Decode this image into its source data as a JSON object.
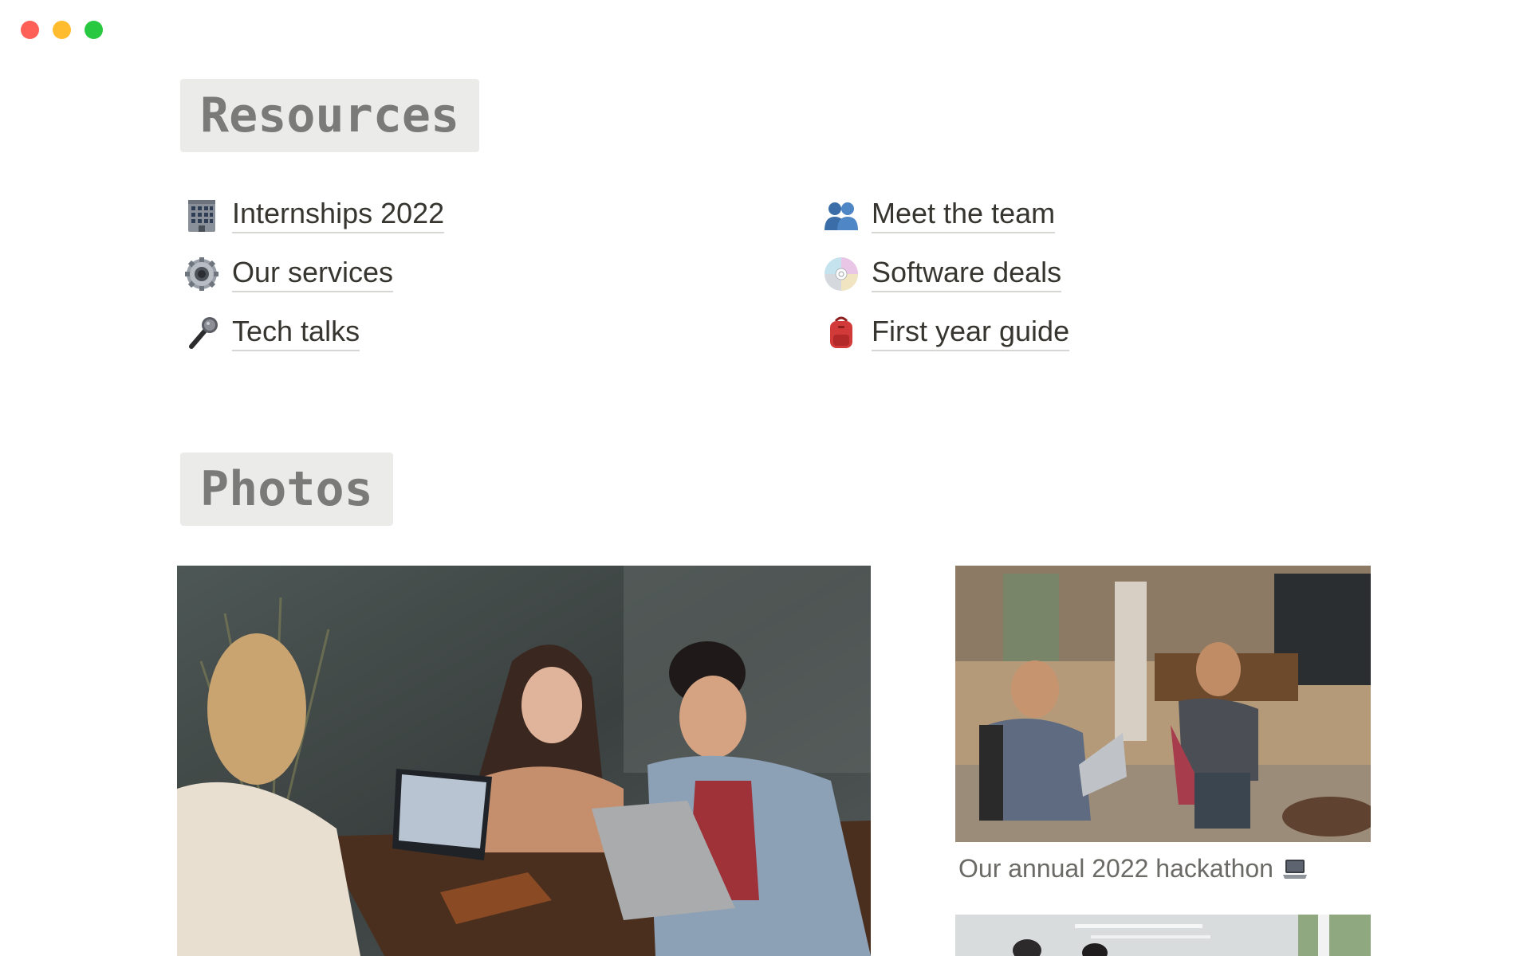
{
  "window": {
    "controls": [
      "close-icon",
      "minimize-icon",
      "maximize-icon"
    ],
    "colors": {
      "close": "#fe5f57",
      "minimize": "#febc2e",
      "maximize": "#28c840"
    }
  },
  "resources": {
    "heading": "Resources",
    "links": [
      {
        "label": "Internships 2022",
        "icon": "office-building-icon"
      },
      {
        "label": "Our services",
        "icon": "gear-icon"
      },
      {
        "label": "Tech talks",
        "icon": "microphone-icon"
      },
      {
        "label": "Meet the team",
        "icon": "people-silhouette-icon"
      },
      {
        "label": "Software deals",
        "icon": "cd-disc-icon"
      },
      {
        "label": "First year guide",
        "icon": "backpack-icon"
      }
    ]
  },
  "photos": {
    "heading": "Photos",
    "items": [
      {
        "name": "students-with-laptops-photo"
      },
      {
        "name": "hackathon-photo",
        "caption": "Our annual 2022 hackathon",
        "caption_icon": "laptop-icon"
      },
      {
        "name": "office-photo"
      }
    ]
  }
}
